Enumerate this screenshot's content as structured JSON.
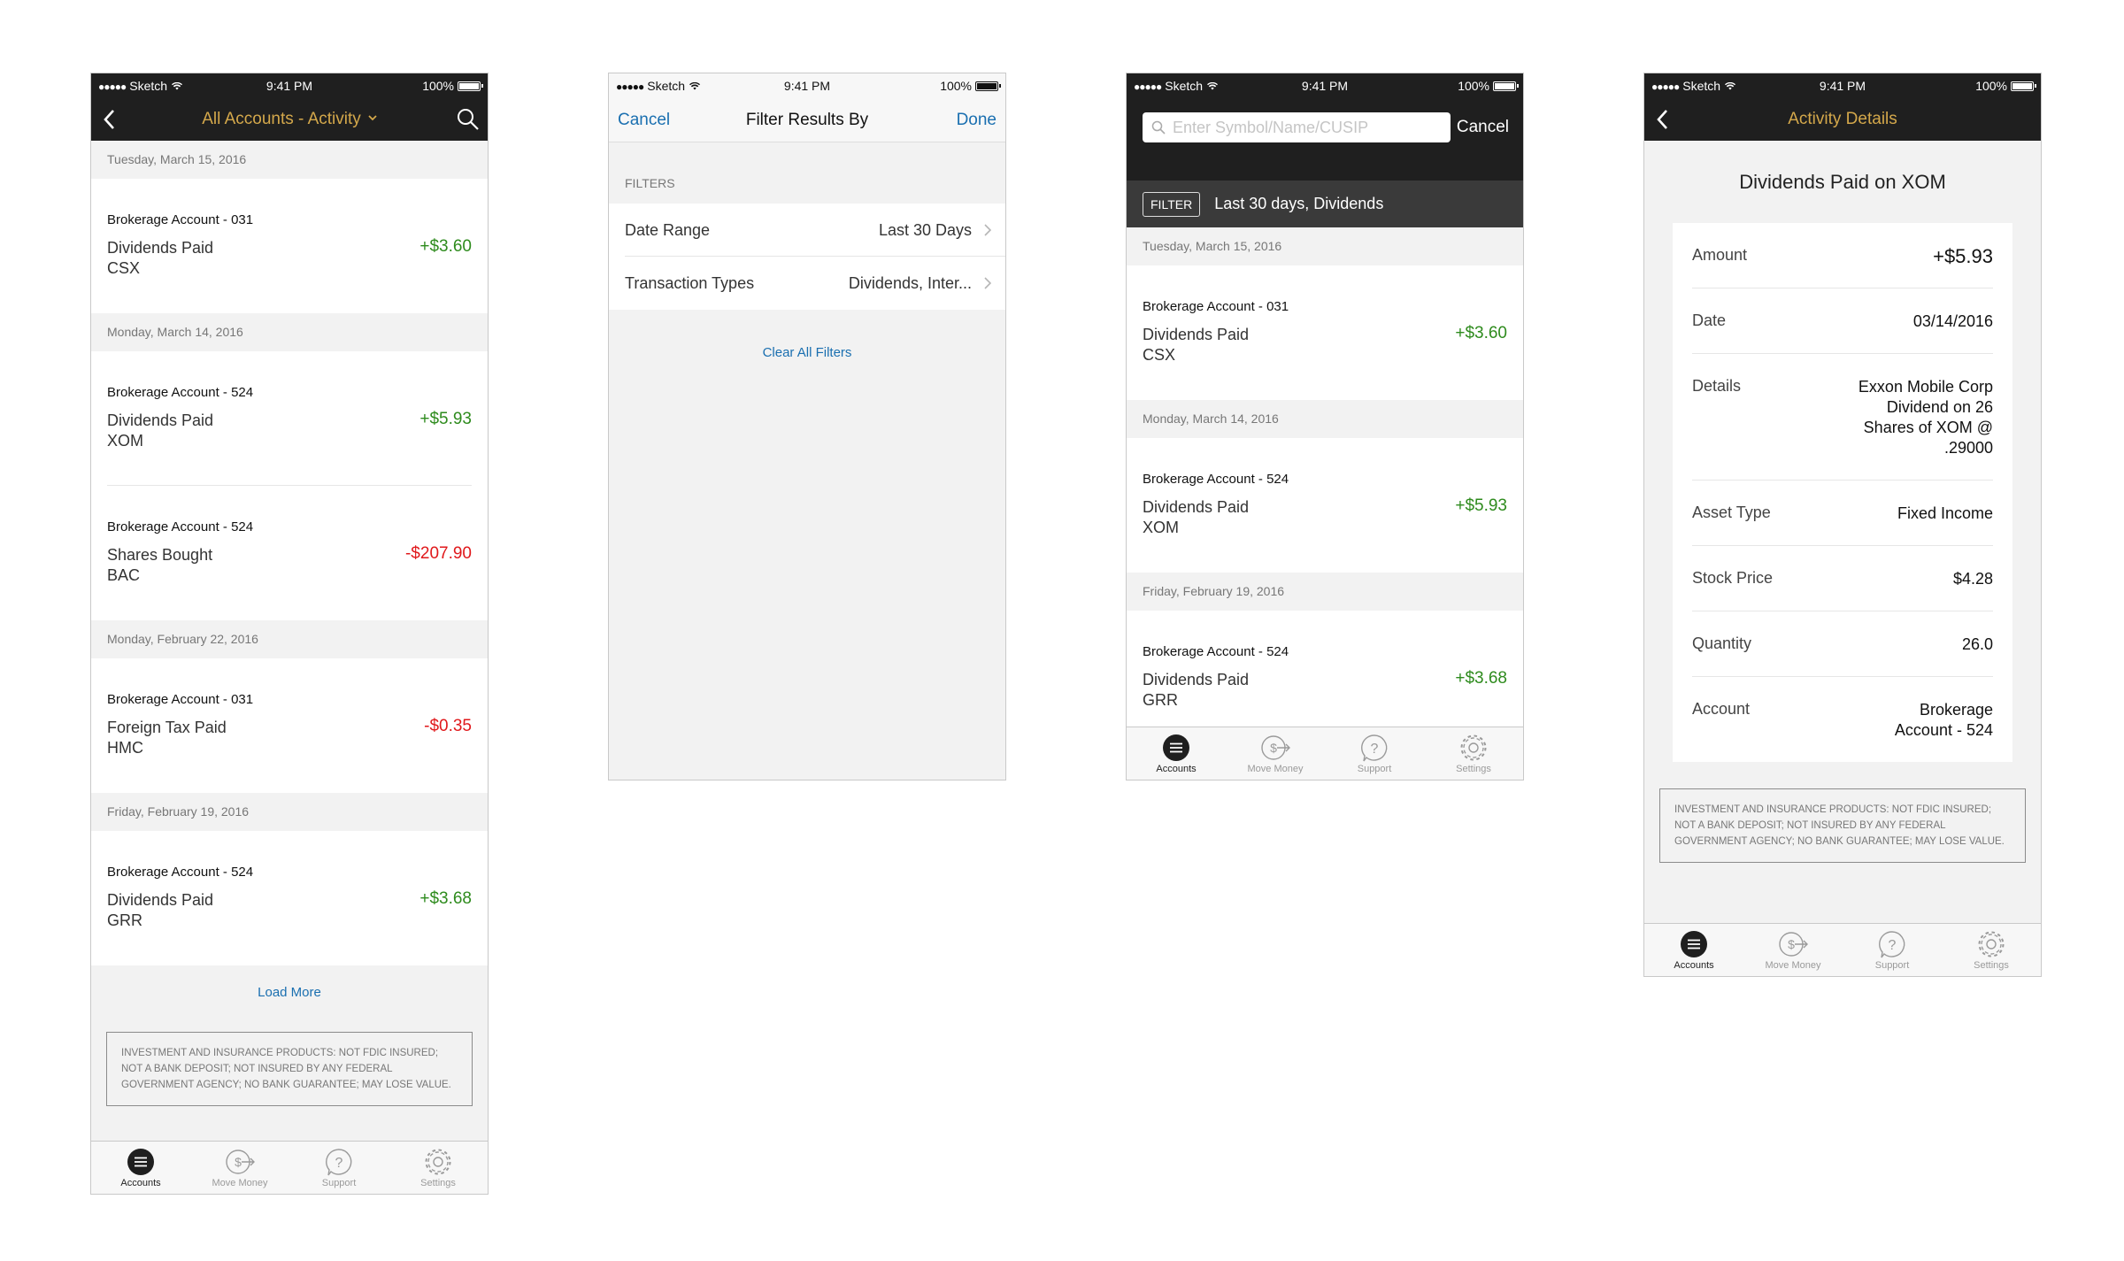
{
  "status": {
    "carrier": "Sketch",
    "time": "9:41 PM",
    "battery": "100%"
  },
  "colors": {
    "positive": "#2e8b1d",
    "negative": "#e0181b",
    "link": "#1a6fb0",
    "accent": "#d4a84b",
    "dark_bar": "#1f1f1f"
  },
  "tabs": [
    {
      "label": "Accounts",
      "icon": "accounts-icon",
      "active": true
    },
    {
      "label": "Move Money",
      "icon": "move-money-icon",
      "active": false
    },
    {
      "label": "Support",
      "icon": "support-icon",
      "active": false
    },
    {
      "label": "Settings",
      "icon": "settings-icon",
      "active": false
    }
  ],
  "disclaimer": "INVESTMENT AND INSURANCE PRODUCTS: NOT FDIC INSURED; NOT A BANK DEPOSIT; NOT INSURED BY ANY FEDERAL GOVERNMENT AGENCY; NO BANK GUARANTEE; MAY LOSE VALUE.",
  "activity": {
    "title": "All Accounts - Activity",
    "load_more": "Load More",
    "groups": [
      {
        "date": "Tuesday, March 15, 2016",
        "items": [
          {
            "account": "Brokerage Account - 031",
            "type": "Dividends Paid",
            "symbol": "CSX",
            "amount": "+$3.60"
          }
        ]
      },
      {
        "date": "Monday, March 14, 2016",
        "items": [
          {
            "account": "Brokerage Account - 524",
            "type": "Dividends Paid",
            "symbol": "XOM",
            "amount": "+$5.93"
          },
          {
            "account": "Brokerage Account - 524",
            "type": "Shares Bought",
            "symbol": "BAC",
            "amount": "-$207.90"
          }
        ]
      },
      {
        "date": "Monday, February 22, 2016",
        "items": [
          {
            "account": "Brokerage Account - 031",
            "type": "Foreign Tax Paid",
            "symbol": "HMC",
            "amount": "-$0.35"
          }
        ]
      },
      {
        "date": "Friday, February 19, 2016",
        "items": [
          {
            "account": "Brokerage Account - 524",
            "type": "Dividends Paid",
            "symbol": "GRR",
            "amount": "+$3.68"
          }
        ]
      }
    ]
  },
  "filter": {
    "cancel": "Cancel",
    "title": "Filter Results By",
    "done": "Done",
    "section": "FILTERS",
    "rows": [
      {
        "label": "Date Range",
        "value": "Last 30 Days"
      },
      {
        "label": "Transaction Types",
        "value": "Dividends, Inter..."
      }
    ],
    "clear": "Clear All Filters"
  },
  "search": {
    "placeholder": "Enter Symbol/Name/CUSIP",
    "cancel": "Cancel",
    "filter_badge": "FILTER",
    "filter_summary": "Last 30 days, Dividends",
    "groups": [
      {
        "date": "Tuesday, March 15, 2016",
        "account": "Brokerage Account - 031",
        "type": "Dividends Paid",
        "symbol": "CSX",
        "amount": "+$3.60"
      },
      {
        "date": "Monday, March 14, 2016",
        "account": "Brokerage Account - 524",
        "type": "Dividends Paid",
        "symbol": "XOM",
        "amount": "+$5.93"
      },
      {
        "date": "Friday, February 19, 2016",
        "account": "Brokerage Account - 524",
        "type": "Dividends Paid",
        "symbol": "GRR",
        "amount": "+$3.68"
      }
    ]
  },
  "details": {
    "title": "Activity Details",
    "heading": "Dividends Paid on XOM",
    "rows": [
      {
        "key": "Amount",
        "value": "+$5.93"
      },
      {
        "key": "Date",
        "value": "03/14/2016"
      },
      {
        "key": "Details",
        "value_lines": [
          "Exxon Mobile Corp",
          "Dividend on 26",
          "Shares of XOM @",
          ".29000"
        ]
      },
      {
        "key": "Asset Type",
        "value": "Fixed Income"
      },
      {
        "key": "Stock Price",
        "value": "$4.28"
      },
      {
        "key": "Quantity",
        "value": "26.0"
      },
      {
        "key": "Account",
        "value_lines": [
          "Brokerage",
          "Account - 524"
        ]
      }
    ]
  }
}
